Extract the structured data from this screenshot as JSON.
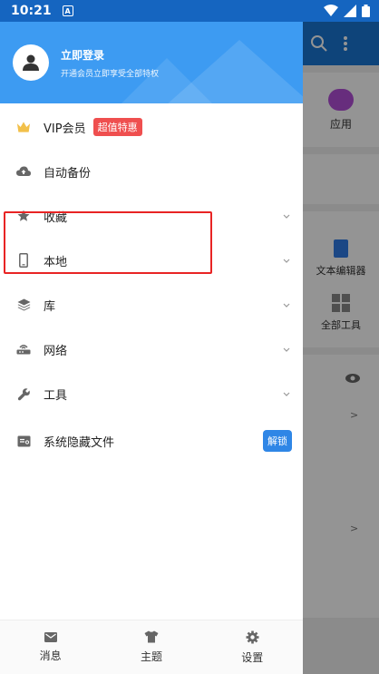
{
  "status_bar": {
    "time": "10:21",
    "notification_letter": "A"
  },
  "drawer": {
    "header": {
      "login_text": "立即登录",
      "subtitle": "开通会员立即享受全部特权"
    },
    "menu": [
      {
        "label": "VIP会员",
        "icon": "crown-icon",
        "badge": "超值特惠"
      },
      {
        "label": "自动备份",
        "icon": "cloud-icon"
      },
      {
        "label": "收藏",
        "icon": "star-icon"
      },
      {
        "label": "本地",
        "icon": "phone-icon"
      },
      {
        "label": "库",
        "icon": "layers-icon"
      },
      {
        "label": "网络",
        "icon": "router-icon"
      },
      {
        "label": "工具",
        "icon": "wrench-icon"
      },
      {
        "label": "系统隐藏文件",
        "icon": "hidden-file-icon",
        "action": "解锁"
      }
    ],
    "bottom_tabs": [
      {
        "label": "消息",
        "icon": "mail-icon"
      },
      {
        "label": "主题",
        "icon": "shirt-icon"
      },
      {
        "label": "设置",
        "icon": "gear-icon"
      }
    ]
  },
  "background_app": {
    "apps_label": "应用",
    "text_editor_label": "文本编辑器",
    "all_tools_label": "全部工具"
  },
  "colors": {
    "header_blue": "#3d9bf2",
    "status_blue": "#1565c0",
    "highlight_red": "#e82424",
    "badge_red": "#ef4f4f",
    "badge_blue": "#2f86e6"
  }
}
